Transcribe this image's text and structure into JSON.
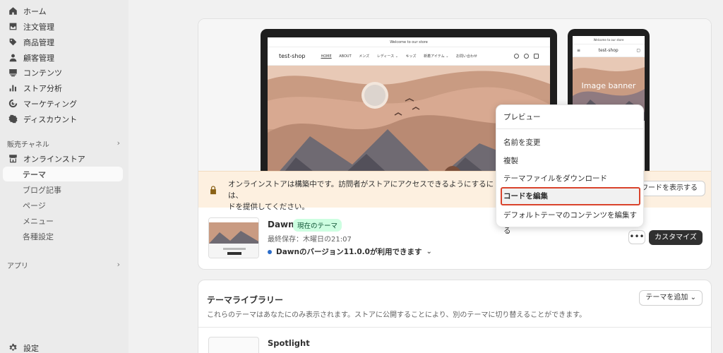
{
  "sidebar": {
    "items": [
      {
        "label": "ホーム",
        "icon": "home-icon"
      },
      {
        "label": "注文管理",
        "icon": "inbox-icon"
      },
      {
        "label": "商品管理",
        "icon": "tag-icon"
      },
      {
        "label": "顧客管理",
        "icon": "person-icon"
      },
      {
        "label": "コンテンツ",
        "icon": "content-icon"
      },
      {
        "label": "ストア分析",
        "icon": "bar-chart-icon"
      },
      {
        "label": "マーケティング",
        "icon": "target-icon"
      },
      {
        "label": "ディスカウント",
        "icon": "discount-icon"
      }
    ],
    "sales_channels_title": "販売チャネル",
    "online_store": "オンラインストア",
    "online_store_sub": [
      {
        "label": "テーマ"
      },
      {
        "label": "ブログ記事"
      },
      {
        "label": "ページ"
      },
      {
        "label": "メニュー"
      },
      {
        "label": "各種設定"
      }
    ],
    "apps_title": "アプリ",
    "settings": "設定"
  },
  "preview": {
    "announcement": "Welcome to our store",
    "store_name": "test-shop",
    "nav_links": [
      "HOME",
      "ABOUT",
      "メンズ",
      "レディース ⌄",
      "キッズ",
      "新着アイテム ⌄",
      "お問い合わせ"
    ],
    "mobile_banner": "Image banner"
  },
  "notice": {
    "message": "オンラインストアは構築中です。訪問者がストアにアクセスできるようにするには、パスワードを提供してください。",
    "message_line1": "オンラインストアは構築中です。訪問者がストアにアクセスできるようにするには、",
    "message_line2": "ドを提供してください。",
    "button": "ワードを表示する"
  },
  "current_theme": {
    "name": "Dawn",
    "badge": "現在のテーマ",
    "saved": "最終保存：木曜日の21:07",
    "update": "Dawnのバージョン11.0.0が利用できます",
    "more": "•••",
    "customize": "カスタマイズ"
  },
  "menu": {
    "items": [
      {
        "label": "プレビュー"
      },
      {
        "label": "名前を変更"
      },
      {
        "label": "複製"
      },
      {
        "label": "テーマファイルをダウンロード"
      },
      {
        "label": "コードを編集"
      },
      {
        "label": "デフォルトテーマのコンテンツを編集する"
      }
    ]
  },
  "library": {
    "title": "テーマライブラリー",
    "description": "これらのテーマはあなたにのみ表示されます。ストアに公開することにより、別のテーマに切り替えることができます。",
    "add_button": "テーマを追加",
    "themes": [
      {
        "name": "Spotlight"
      }
    ]
  },
  "colors": {
    "highlight_outline": "#d9432c",
    "badge_bg": "#cdfee1",
    "notice_bg": "#fdf0e0",
    "primary_button": "#303030"
  }
}
